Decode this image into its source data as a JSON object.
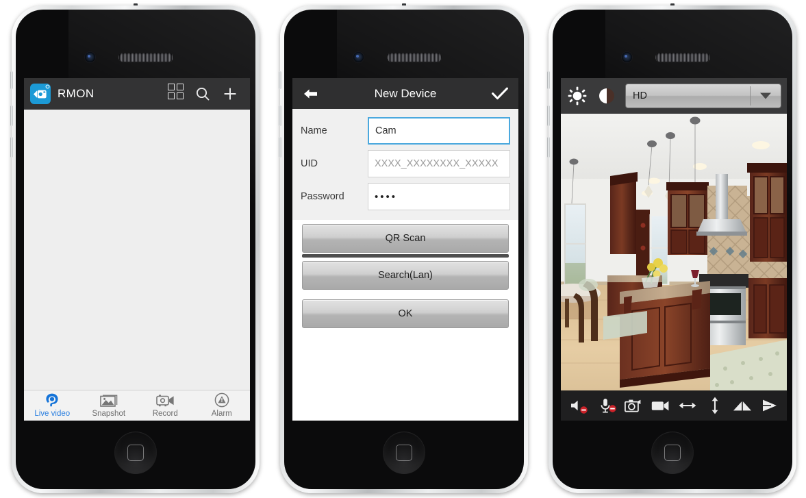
{
  "phones": [
    {
      "id": "device-list-phone",
      "app_bar": {
        "app_icon": "camcorder-icon",
        "title": "RMON",
        "actions": [
          "grid-view-icon",
          "search-icon",
          "add-icon"
        ]
      },
      "list_area": {
        "items": []
      },
      "tabbar": [
        {
          "label": "Live video",
          "icon": "live-video-icon",
          "active": true
        },
        {
          "label": "Snapshot",
          "icon": "photo-icon",
          "active": false
        },
        {
          "label": "Record",
          "icon": "camcorder-icon",
          "active": false
        },
        {
          "label": "Alarm",
          "icon": "alarm-icon",
          "active": false
        }
      ]
    },
    {
      "id": "new-device-phone",
      "nav_bar": {
        "back": "back-arrow-icon",
        "title": "New Device",
        "confirm": "checkmark-icon"
      },
      "form": [
        {
          "label": "Name",
          "value": "Cam",
          "placeholder": "",
          "focused": true,
          "masked": false
        },
        {
          "label": "UID",
          "value": "",
          "placeholder": "XXXX_XXXXXXXX_XXXXX",
          "focused": false,
          "masked": false
        },
        {
          "label": "Password",
          "value": "••••",
          "placeholder": "",
          "focused": false,
          "masked": true
        }
      ],
      "buttons": [
        {
          "label": "QR Scan"
        },
        {
          "label": "Search(Lan)"
        },
        {
          "label": "OK"
        }
      ]
    },
    {
      "id": "live-view-phone",
      "toolbar": {
        "brightness_icon": "brightness-sun-icon",
        "contrast_icon": "contrast-icon",
        "quality": {
          "value": "HD",
          "caret": "chevron-down-icon"
        }
      },
      "video": {
        "description": "kitchen-live-feed"
      },
      "controls": [
        {
          "name": "speaker-mute-button",
          "icon": "speaker-icon",
          "badge": "disabled"
        },
        {
          "name": "microphone-mute-button",
          "icon": "microphone-icon",
          "badge": "disabled"
        },
        {
          "name": "snapshot-button",
          "icon": "camera-icon",
          "badge": ""
        },
        {
          "name": "record-button",
          "icon": "camcorder-icon",
          "badge": ""
        },
        {
          "name": "pan-horizontal-button",
          "icon": "arrows-horizontal-icon",
          "badge": ""
        },
        {
          "name": "pan-vertical-button",
          "icon": "arrows-vertical-icon",
          "badge": ""
        },
        {
          "name": "mirror-button",
          "icon": "mirror-icon",
          "badge": ""
        },
        {
          "name": "play-button",
          "icon": "play-icon",
          "badge": ""
        }
      ]
    }
  ],
  "colors": {
    "accent_blue": "#2a7fe0",
    "app_icon_blue": "#1c9ad6",
    "app_bar_dark": "#333334",
    "nav_bar_dark": "#2f2f30",
    "badge_red": "#cc2229",
    "focus_border": "#4aa8de"
  }
}
